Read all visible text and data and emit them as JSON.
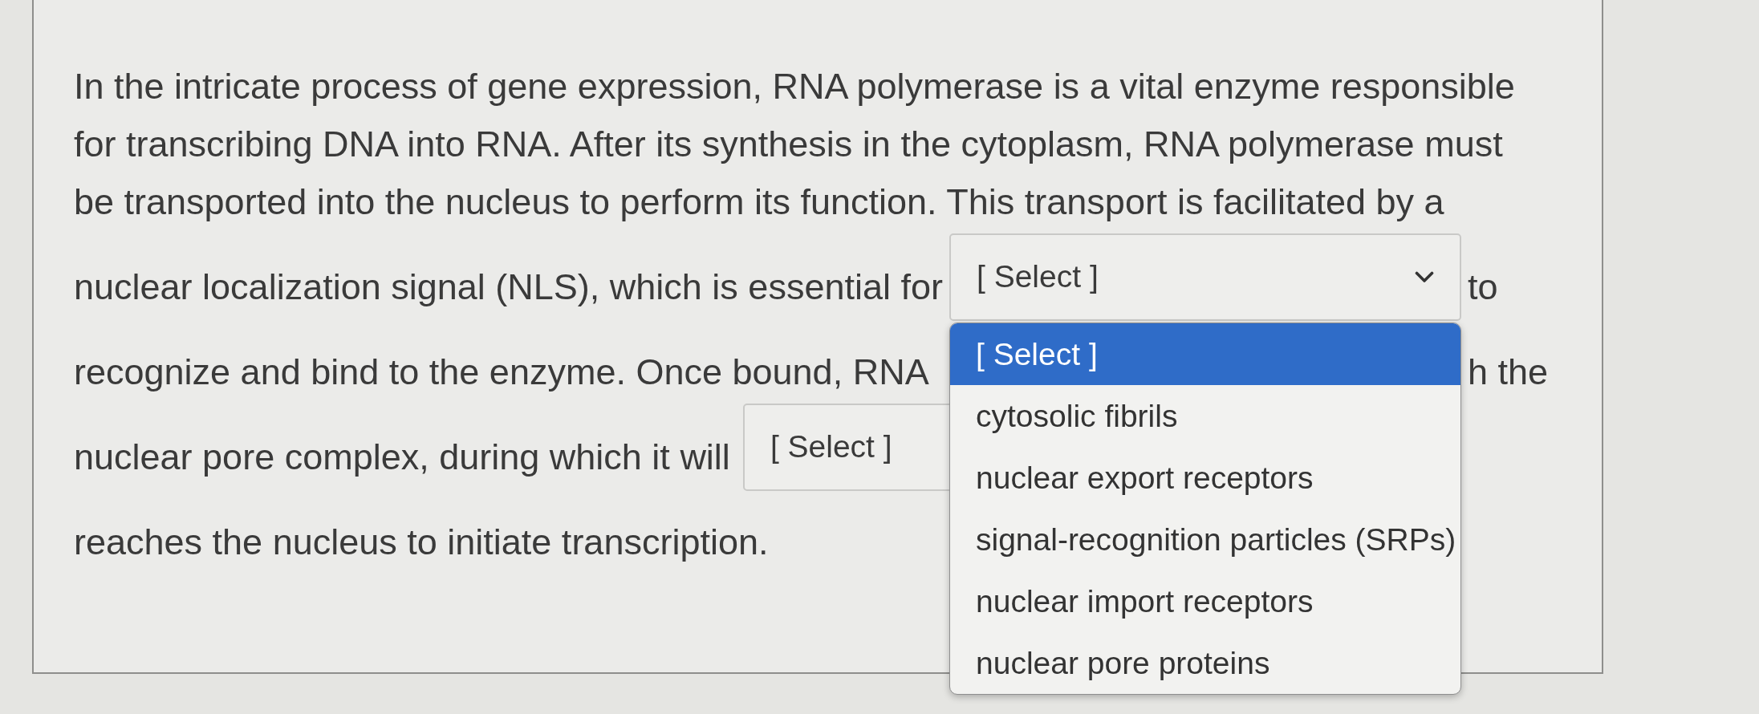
{
  "question": {
    "lines": [
      {
        "kind": "text",
        "text": "In the intricate process of gene expression, RNA polymerase is a vital enzyme responsible"
      },
      {
        "kind": "text",
        "text": "for transcribing DNA into RNA. After its synthesis in the cytoplasm, RNA polymerase must"
      },
      {
        "kind": "text",
        "text": "be transported into the nucleus to perform its function. This transport is facilitated by a"
      },
      {
        "kind": "blank",
        "before": "nuclear localization signal (NLS), which is essential for",
        "select": {
          "value": "[ Select ]",
          "caret": true,
          "open": true,
          "options": [
            {
              "label": "[ Select ]",
              "selected": true
            },
            {
              "label": "cytosolic fibrils",
              "selected": false
            },
            {
              "label": "nuclear export receptors",
              "selected": false
            },
            {
              "label": "signal-recognition particles (SRPs)",
              "selected": false
            },
            {
              "label": "nuclear import receptors",
              "selected": false
            },
            {
              "label": "nuclear pore proteins",
              "selected": false
            }
          ]
        },
        "after": "to"
      },
      {
        "kind": "covered",
        "before": "recognize and bind to the enzyme. Once bound, RNA",
        "after": "h the"
      },
      {
        "kind": "blank",
        "before": "nuclear pore complex, during which it will",
        "select": {
          "value": "[ Select ]",
          "caret": false
        }
      },
      {
        "kind": "text",
        "text": "reaches the nucleus to initiate transcription."
      }
    ]
  }
}
